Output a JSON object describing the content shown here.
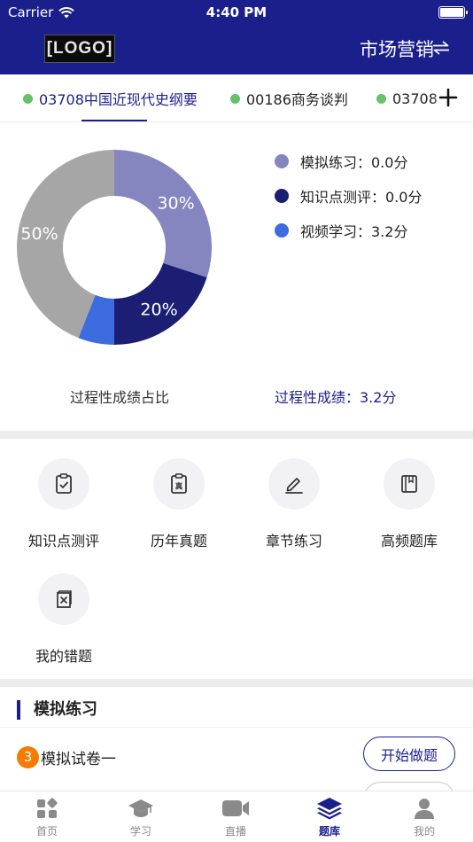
{
  "status_bar": {
    "carrier": "Carrier",
    "time": "4:40 PM"
  },
  "header": {
    "logo_text": "[LOGO]",
    "major": "市场营销"
  },
  "course_tabs": [
    {
      "label": "03708中国近现代史纲要",
      "active": true
    },
    {
      "label": "00186商务谈判",
      "active": false
    },
    {
      "label": "03708",
      "active": false
    }
  ],
  "chart_data": {
    "type": "pie",
    "donut": true,
    "slices": [
      {
        "label": "模拟练习",
        "percent": 30,
        "display": "30%",
        "color": "#8585c0"
      },
      {
        "label": "知识点测评",
        "percent": 20,
        "display": "20%",
        "color": "#1b1e73"
      },
      {
        "label": "视频学习",
        "percent": 6,
        "display": "",
        "color": "#3d6be0"
      },
      {
        "label": "",
        "percent": 44,
        "display": "50%",
        "color": "#a6a6a6"
      }
    ],
    "legend": [
      {
        "text": "模拟练习：0.0分",
        "color": "#8585c0"
      },
      {
        "text": "知识点测评：0.0分",
        "color": "#1b1e73"
      },
      {
        "text": "视频学习：3.2分",
        "color": "#3d6be0"
      }
    ],
    "caption": "过程性成绩占比",
    "score_text": "过程性成绩：3.2分"
  },
  "functions": [
    {
      "label": "知识点测评",
      "icon": "clipboard-check-icon"
    },
    {
      "label": "历年真题",
      "icon": "clipboard-real-icon"
    },
    {
      "label": "章节练习",
      "icon": "pen-icon"
    },
    {
      "label": "高频题库",
      "icon": "book-icon"
    },
    {
      "label": "我的错题",
      "icon": "wrong-book-icon"
    }
  ],
  "mock_exam": {
    "title": "模拟练习",
    "papers": [
      {
        "index": "3",
        "name": "模拟试卷一",
        "button": "开始做题"
      }
    ]
  },
  "tabbar": [
    {
      "label": "首页",
      "icon": "home-grid-icon",
      "active": false
    },
    {
      "label": "学习",
      "icon": "graduation-cap-icon",
      "active": false
    },
    {
      "label": "直播",
      "icon": "video-camera-icon",
      "active": false
    },
    {
      "label": "题库",
      "icon": "layers-icon",
      "active": true
    },
    {
      "label": "我的",
      "icon": "user-icon",
      "active": false
    }
  ],
  "colors": {
    "brand": "#1b1f8c",
    "badge": "#f57c00",
    "tab_dot": "#66c26a"
  }
}
